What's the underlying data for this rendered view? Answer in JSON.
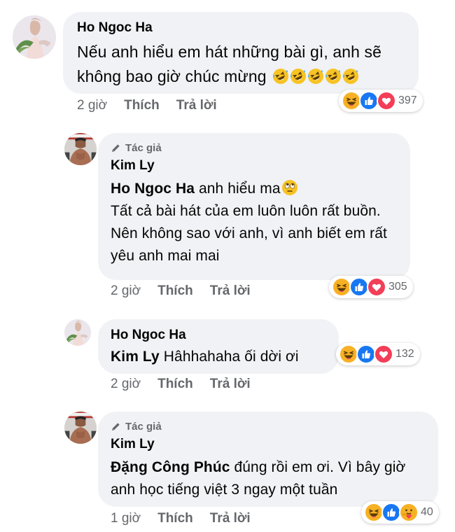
{
  "colors": {
    "bubble": "#f0f2f5",
    "meta": "#65676b",
    "like": "#1877f2",
    "love": "#f33e58",
    "haha": "#f7b125"
  },
  "comments": [
    {
      "name": "Ho Ngoc Ha",
      "text": "Nếu anh hiểu em hát những bài gì, anh sẽ không bao giờ chúc mừng",
      "emoji": "rolling-laughing-emoji",
      "time": "2 giờ",
      "like": "Thích",
      "reply": "Trả lời",
      "reactions": [
        "haha",
        "like",
        "love"
      ],
      "count": "397"
    },
    {
      "author_tag": "Tác giả",
      "name": "Kim Ly",
      "mention": "Ho Ngoc Ha",
      "text_first": "anh hiểu ma",
      "text_rest": "Tất cả bài hát của em luôn luôn rất buồn. Nên không sao với anh, vì anh biết em rất yêu anh mai mai",
      "emoji": "rolling-eyes-emoji",
      "time": "2 giờ",
      "like": "Thích",
      "reply": "Trả lời",
      "reactions": [
        "haha",
        "like",
        "love"
      ],
      "count": "305"
    },
    {
      "name": "Ho Ngoc Ha",
      "mention": "Kim Ly",
      "text": "Hâhhahaha ối dời ơi",
      "time": "2 giờ",
      "like": "Thích",
      "reply": "Trả lời",
      "reactions": [
        "haha",
        "like",
        "love"
      ],
      "count": "132"
    },
    {
      "author_tag": "Tác giả",
      "name": "Kim Ly",
      "mention": "Đặng Công Phúc",
      "text": "đúng rồi em ơi. Vì bây giờ anh học tiếng việt 3 ngay một tuần",
      "time": "1 giờ",
      "like": "Thích",
      "reply": "Trả lời",
      "reactions": [
        "haha",
        "like",
        "care"
      ],
      "count": "40"
    }
  ]
}
